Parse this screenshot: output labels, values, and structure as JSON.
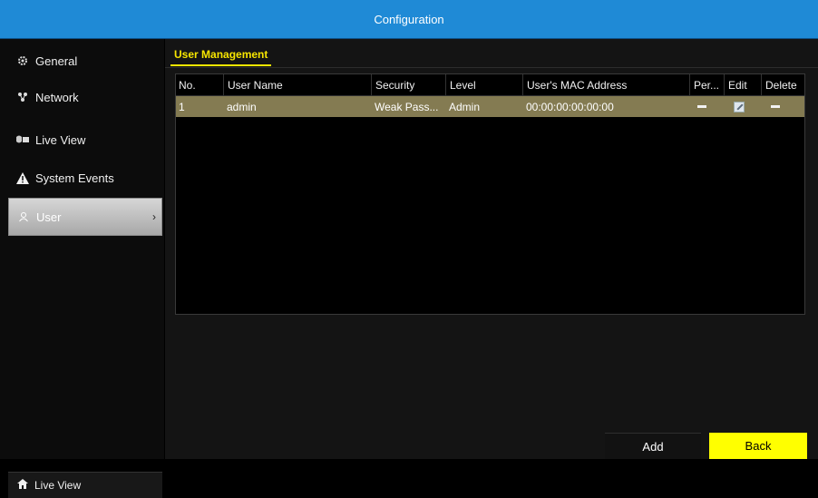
{
  "window": {
    "title": "Configuration"
  },
  "sidebar": {
    "items": [
      {
        "label": "General",
        "icon": "gear-icon"
      },
      {
        "label": "Network",
        "icon": "network-icon"
      },
      {
        "label": "Live View",
        "icon": "camera-icon"
      },
      {
        "label": "System Events",
        "icon": "warning-icon"
      },
      {
        "label": "User",
        "icon": "user-icon",
        "active": true
      }
    ],
    "bottom_live_view": "Live View"
  },
  "main": {
    "tab": "User Management",
    "table": {
      "columns": [
        "No.",
        "User Name",
        "Security",
        "Level",
        "User's MAC Address",
        "Per...",
        "Edit",
        "Delete"
      ],
      "rows": [
        {
          "no": "1",
          "user_name": "admin",
          "security": "Weak Pass...",
          "level": "Admin",
          "mac": "00:00:00:00:00:00"
        }
      ]
    }
  },
  "buttons": {
    "add": "Add",
    "back": "Back"
  },
  "colors": {
    "title_bar": "#1f8ad6",
    "accent_yellow": "#ffff00",
    "row_selected": "#847b52"
  }
}
